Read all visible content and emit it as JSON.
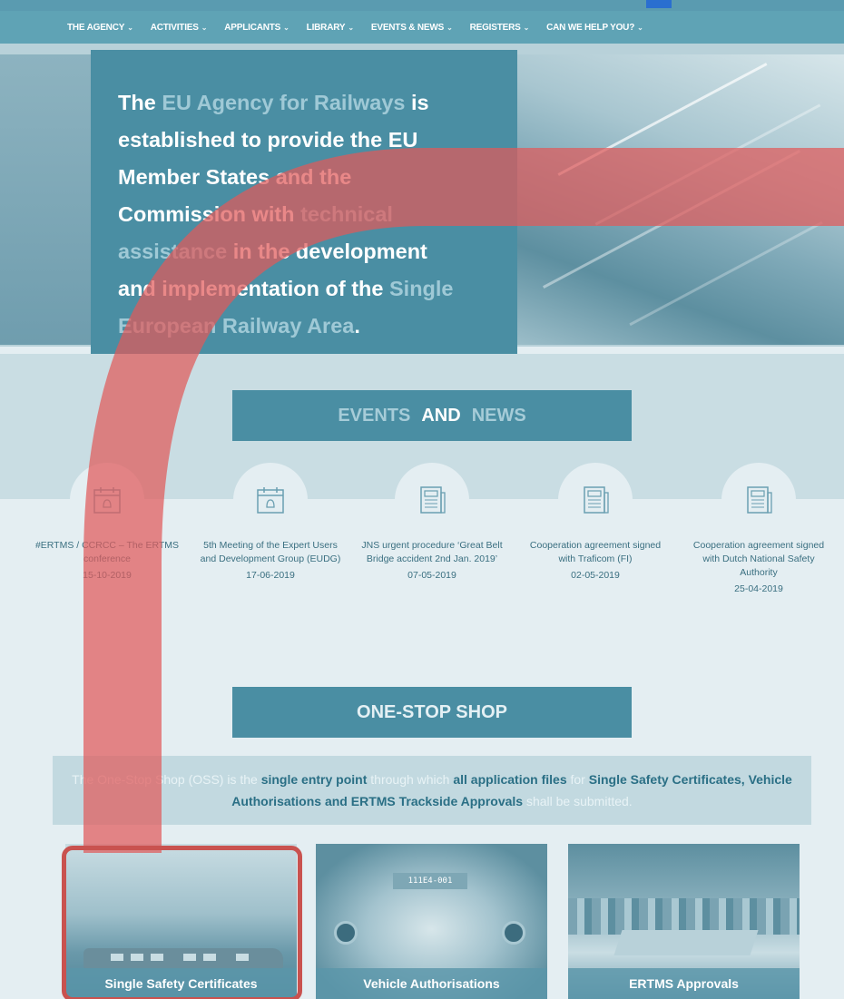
{
  "nav": {
    "items": [
      {
        "label": "THE AGENCY"
      },
      {
        "label": "ACTIVITIES"
      },
      {
        "label": "APPLICANTS"
      },
      {
        "label": "LIBRARY"
      },
      {
        "label": "EVENTS & NEWS"
      },
      {
        "label": "REGISTERS"
      },
      {
        "label": "CAN WE HELP YOU?"
      }
    ],
    "chevron_icon": "chevron-down-icon"
  },
  "hero": {
    "lines": [
      [
        {
          "t": "The ",
          "s": "b"
        },
        {
          "t": "EU Agency for Railways",
          "s": "l"
        },
        {
          "t": " is",
          "s": "b"
        }
      ],
      [
        {
          "t": "established to provide the EU",
          "s": "b"
        }
      ],
      [
        {
          "t": "Member States and the",
          "s": "b"
        }
      ],
      [
        {
          "t": "Commission with ",
          "s": "b"
        },
        {
          "t": "technical",
          "s": "l"
        }
      ],
      [
        {
          "t": "assistance",
          "s": "l"
        },
        {
          "t": " in the development",
          "s": "b"
        }
      ],
      [
        {
          "t": "and implementation of the ",
          "s": "b"
        },
        {
          "t": "Single",
          "s": "l"
        }
      ],
      [
        {
          "t": "European Railway Area",
          "s": "l"
        },
        {
          "t": ".",
          "s": "b"
        }
      ]
    ]
  },
  "events_section": {
    "title_part1": "EVENTS",
    "title_part2": "AND",
    "title_part3": "NEWS",
    "items": [
      {
        "icon": "calendar-icon",
        "title": "#ERTMS / CCRCC – The ERTMS conference",
        "date": "15-10-2019"
      },
      {
        "icon": "calendar-icon",
        "title": "5th Meeting of the Expert Users and Development Group (EUDG)",
        "date": "17-06-2019"
      },
      {
        "icon": "newspaper-icon",
        "title": "JNS urgent procedure ‘Great Belt Bridge accident 2nd Jan. 2019’",
        "date": "07-05-2019"
      },
      {
        "icon": "newspaper-icon",
        "title": "Cooperation agreement signed with Traficom (FI)",
        "date": "02-05-2019"
      },
      {
        "icon": "newspaper-icon",
        "title": "Cooperation agreement signed with Dutch National Safety Authority",
        "date": "25-04-2019"
      }
    ]
  },
  "oss": {
    "title": "ONE-STOP SHOP",
    "desc": {
      "p1": "The One-Stop Shop (OSS) is the ",
      "b1": "single entry point",
      "p2": " through which ",
      "b2": "all application files",
      "p3": " for ",
      "b3": "Single Safety Certificates, Vehicle Authorisations and ERTMS Trackside Approvals",
      "p4": " shall be submitted."
    },
    "cards": [
      {
        "label": "Single Safety Certificates"
      },
      {
        "label": "Vehicle Authorisations",
        "plate": "111E4-001"
      },
      {
        "label": "ERTMS Approvals"
      }
    ]
  },
  "colors": {
    "nav_bg": "#5fa3b5",
    "teal_box": "#4a8ea3",
    "highlight_red": "#c9524f",
    "arrow_red": "#e05a5a"
  }
}
